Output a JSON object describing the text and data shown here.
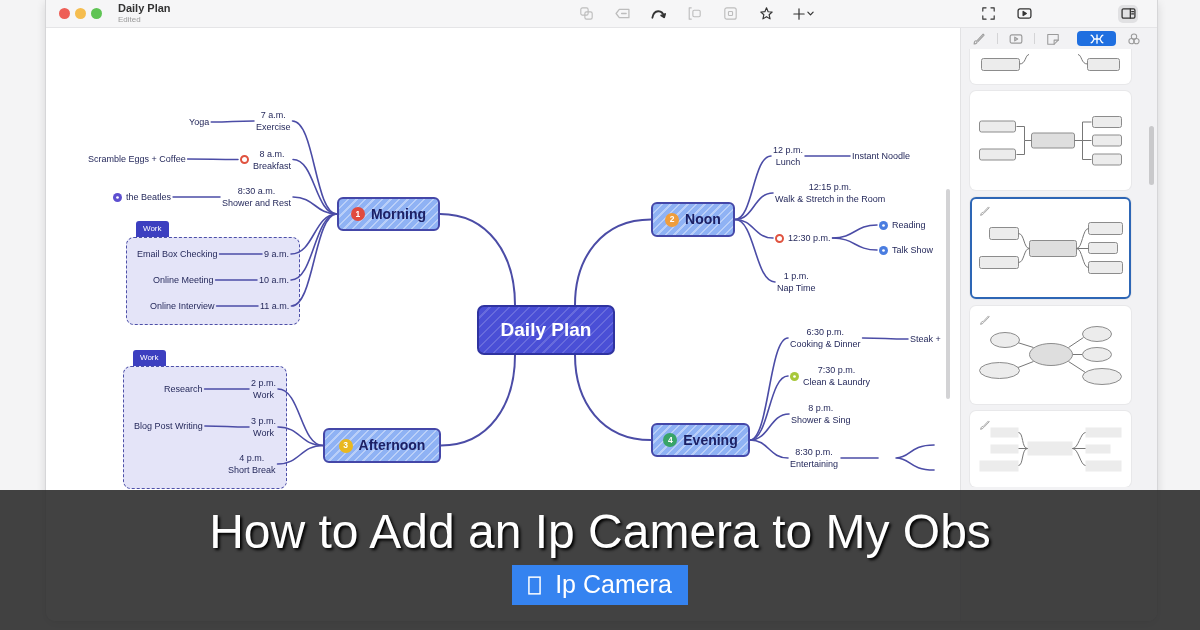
{
  "window": {
    "title": "Daily Plan",
    "subtitle": "Edited"
  },
  "toolbar": [
    {
      "disabled": true
    },
    {
      "disabled": true
    },
    {
      "disabled": false
    },
    {
      "disabled": true
    },
    {
      "disabled": true
    },
    {
      "disabled": false
    },
    {
      "disabled": false
    }
  ],
  "view_buttons": [
    {
      "selected": false
    },
    {
      "selected": false
    },
    {
      "selected": true
    }
  ],
  "mind_map": {
    "central": "Daily Plan",
    "topics": [
      {
        "label": "Morning",
        "priority": {
          "label": "1",
          "color": "#e04a3f"
        },
        "children": [
          {
            "time": "7 a.m.",
            "label": "Exercise",
            "children": [
              {
                "label": "Yoga"
              }
            ]
          },
          {
            "time": "8 a.m.",
            "label": "Breakfast",
            "marker": {
              "kind": "ring",
              "color": "#e0533f"
            },
            "children": [
              {
                "label": "Scramble Eggs + Coffee"
              }
            ]
          },
          {
            "time": "8:30 a.m.",
            "label": "Shower and Rest",
            "children": [
              {
                "label": "the Beatles",
                "marker": {
                  "kind": "dot",
                  "color": "#5d4fd0"
                }
              }
            ]
          }
        ],
        "boundary": {
          "label": "Work",
          "children": [
            {
              "label": "9 a.m.",
              "children": [
                {
                  "label": "Email Box Checking"
                }
              ]
            },
            {
              "label": "10 a.m.",
              "children": [
                {
                  "label": "Online Meeting"
                }
              ]
            },
            {
              "label": "11 a.m.",
              "children": [
                {
                  "label": "Online Interview"
                }
              ]
            }
          ]
        }
      },
      {
        "label": "Noon",
        "priority": {
          "label": "2",
          "color": "#ef9d3c"
        },
        "children": [
          {
            "time": "12 p.m.",
            "label": "Lunch",
            "children": [
              {
                "label": "Instant Noodle"
              }
            ]
          },
          {
            "time": "12:15 p.m.",
            "label": "Walk & Stretch in the Room"
          },
          {
            "label": "12:30 p.m.",
            "marker": {
              "kind": "ring",
              "color": "#e0533f"
            },
            "children": [
              {
                "label": "Reading",
                "marker": {
                  "kind": "dot",
                  "color": "#4a7de0"
                }
              },
              {
                "label": "Talk Show",
                "marker": {
                  "kind": "dot",
                  "color": "#4a7de0"
                }
              }
            ]
          },
          {
            "time": "1 p.m.",
            "label": "Nap Time"
          }
        ]
      },
      {
        "label": "Afternoon",
        "priority": {
          "label": "3",
          "color": "#e9b820"
        },
        "boundary": {
          "label": "Work",
          "children": [
            {
              "time": "2 p.m.",
              "label": "Work",
              "children": [
                {
                  "label": "Research"
                }
              ]
            },
            {
              "time": "3 p.m.",
              "label": "Work",
              "children": [
                {
                  "label": "Blog Post Writing"
                }
              ]
            },
            {
              "time": "4 p.m.",
              "label": "Short Break"
            }
          ]
        }
      },
      {
        "label": "Evening",
        "priority": {
          "label": "4",
          "color": "#38a468"
        },
        "children": [
          {
            "time": "6:30 p.m.",
            "label": "Cooking & Dinner",
            "children": [
              {
                "label": "Steak +"
              }
            ]
          },
          {
            "time": "7:30 p.m.",
            "label": "Clean & Laundry",
            "marker": {
              "kind": "dot",
              "color": "#a8c83a"
            }
          },
          {
            "time": "8 p.m.",
            "label": "Shower & Sing"
          },
          {
            "time": "8:30 p.m.",
            "label": "Entertaining",
            "children_offscreen": true
          }
        ]
      }
    ]
  },
  "panel": {
    "tabs": [
      {
        "selected": false
      },
      {
        "selected": false
      },
      {
        "selected": false
      },
      {
        "selected": true
      },
      {
        "selected": false
      }
    ],
    "templates": [
      {
        "kind": "split",
        "selected": false,
        "style_icon": false
      },
      {
        "kind": "org",
        "selected": false,
        "style_icon": false
      },
      {
        "kind": "map",
        "selected": true,
        "style_icon": true
      },
      {
        "kind": "bubble",
        "selected": false,
        "style_icon": true
      },
      {
        "kind": "brace",
        "selected": false,
        "style_icon": true
      }
    ]
  },
  "overlay": {
    "title": "How to Add an Ip Camera to My Obs",
    "tag": "Ip Camera"
  }
}
